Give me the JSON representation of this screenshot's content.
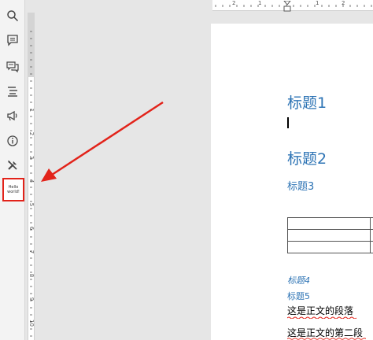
{
  "toolbar": {
    "items": [
      {
        "name": "search-icon"
      },
      {
        "name": "comment-icon"
      },
      {
        "name": "comments-icon"
      },
      {
        "name": "outline-icon"
      },
      {
        "name": "announce-icon"
      },
      {
        "name": "info-icon"
      },
      {
        "name": "tools-icon"
      }
    ],
    "thumbnail_text": "Hello world!"
  },
  "ruler": {
    "corner_label": "L",
    "vertical_numbers": [
      "1",
      "2",
      "3",
      "4",
      "5",
      "6",
      "7",
      "8",
      "9",
      "10"
    ],
    "horizontal_numbers": [
      "2",
      "1",
      "1",
      "2"
    ]
  },
  "document": {
    "heading1": "标题1",
    "heading2": "标题2",
    "heading3": "标题3",
    "heading4": "标题4",
    "heading5": "标题5",
    "paragraph1": "这是正文的段落",
    "paragraph2": "这是正文的第二段"
  },
  "colors": {
    "heading": "#2e74b5",
    "highlight_box": "#e2231a",
    "arrow": "#e2231a"
  }
}
